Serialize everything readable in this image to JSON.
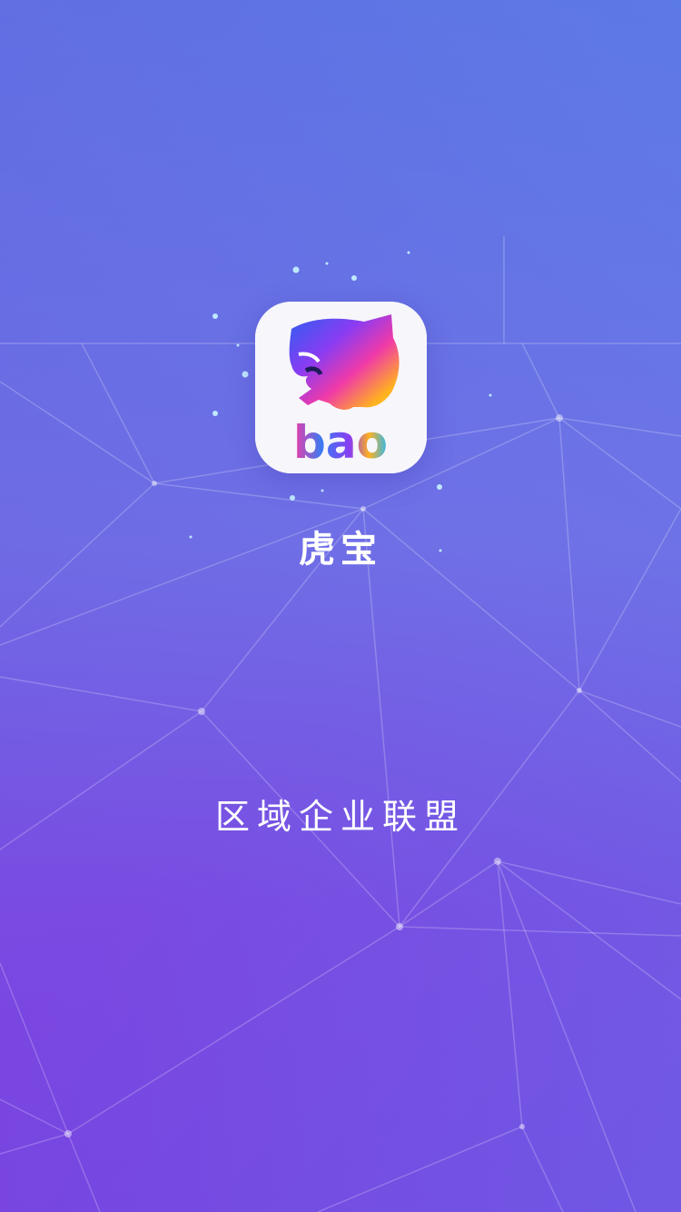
{
  "splash": {
    "app_name": "虎宝",
    "logo_text": "bao",
    "tagline": "区域企业联盟"
  },
  "colors": {
    "background_top": "#5a8ae6",
    "background_bottom": "#7a40e0",
    "logo_tile": "#ffffff",
    "text": "#ffffff"
  }
}
